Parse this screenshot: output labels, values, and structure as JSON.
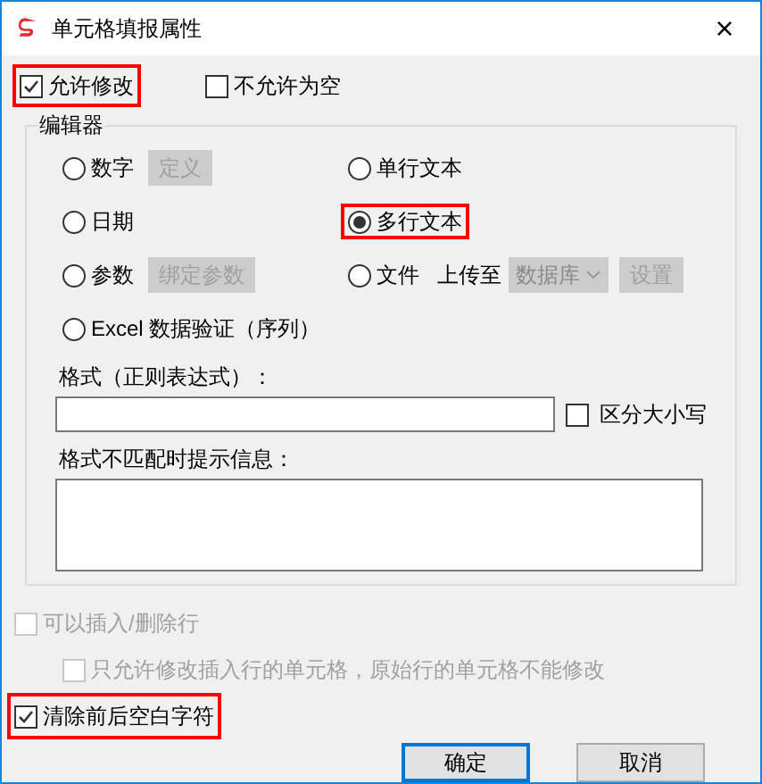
{
  "window": {
    "title": "单元格填报属性",
    "close": "×"
  },
  "top_options": [
    {
      "label": "允许修改",
      "checked": true,
      "highlighted": true
    },
    {
      "label": "不允许为空",
      "checked": false,
      "highlighted": false
    }
  ],
  "editor": {
    "legend": "编辑器",
    "options": [
      {
        "kind": "button",
        "label": "数字",
        "selected": false,
        "highlighted": false,
        "button": {
          "label": "定义",
          "disabled": true
        }
      },
      {
        "kind": "plain",
        "label": "单行文本",
        "selected": false,
        "highlighted": false
      },
      {
        "kind": "plain",
        "label": "日期",
        "selected": false,
        "highlighted": false
      },
      {
        "kind": "plain",
        "label": "多行文本",
        "selected": true,
        "highlighted": true
      },
      {
        "kind": "button",
        "label": "参数",
        "selected": false,
        "highlighted": false,
        "button": {
          "label": "绑定参数",
          "disabled": true
        }
      },
      {
        "kind": "file",
        "label": "文件",
        "selected": false,
        "highlighted": false,
        "upload_label": "上传至",
        "dropdown": {
          "value": "数据库",
          "disabled": true
        },
        "button": {
          "label": "设置",
          "disabled": true
        }
      },
      {
        "kind": "wide",
        "label": "Excel 数据验证（序列）",
        "selected": false,
        "highlighted": false
      }
    ],
    "format_label": "格式（正则表达式）：",
    "case_option": {
      "label": "区分大小写",
      "checked": false
    },
    "message_label": "格式不匹配时提示信息："
  },
  "bottom_options": [
    {
      "label": "可以插入/删除行",
      "checked": false,
      "disabled": true,
      "highlighted": false,
      "indented": false
    },
    {
      "label": "只允许修改插入行的单元格，原始行的单元格不能修改",
      "checked": false,
      "disabled": true,
      "highlighted": false,
      "indented": true
    },
    {
      "label": "清除前后空白字符",
      "checked": true,
      "disabled": false,
      "highlighted": true,
      "indented": false
    }
  ],
  "buttons": [
    {
      "label": "确定",
      "default": true
    },
    {
      "label": "取消",
      "default": false
    }
  ]
}
